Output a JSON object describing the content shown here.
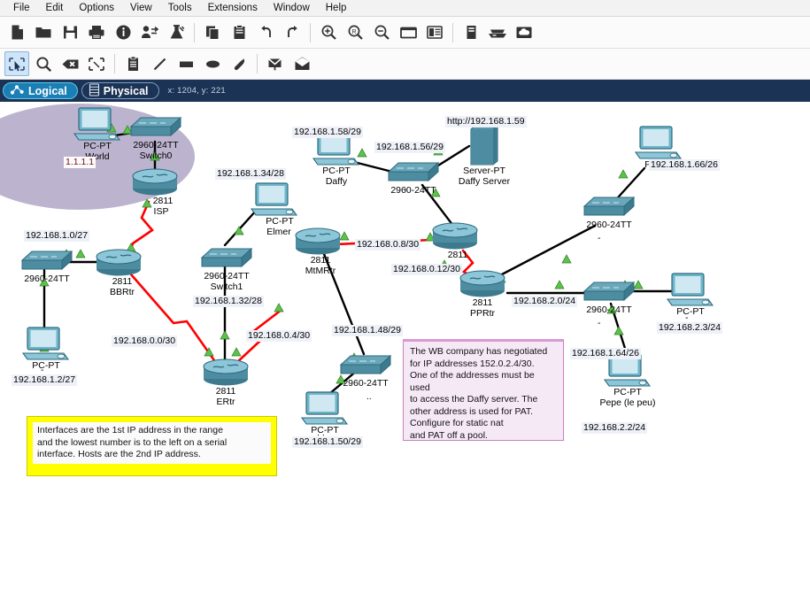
{
  "app": {
    "title": "Cisco Packet Tracer"
  },
  "menubar": {
    "items": [
      {
        "label": "File",
        "name": "menu-file"
      },
      {
        "label": "Edit",
        "name": "menu-edit"
      },
      {
        "label": "Options",
        "name": "menu-options"
      },
      {
        "label": "View",
        "name": "menu-view"
      },
      {
        "label": "Tools",
        "name": "menu-tools"
      },
      {
        "label": "Extensions",
        "name": "menu-extensions"
      },
      {
        "label": "Window",
        "name": "menu-window"
      },
      {
        "label": "Help",
        "name": "menu-help"
      }
    ]
  },
  "toolbar_main": {
    "icons": [
      "new-file-icon",
      "open-folder-icon",
      "save-icon",
      "print-icon",
      "activity-wizard-icon",
      "network-info-icon",
      "flask-icon",
      "sep",
      "copy-icon",
      "paste-icon",
      "undo-icon",
      "redo-icon",
      "sep",
      "zoom-in-icon",
      "zoom-reset-icon",
      "zoom-out-icon",
      "palette-window-icon",
      "user-profile-icon",
      "sep",
      "custom-devices-icon",
      "rack-view-icon",
      "cloud-view-icon"
    ]
  },
  "toolbar_edit": {
    "icons": [
      "select-tool-icon",
      "inspect-magnifier-icon",
      "delete-x-icon",
      "resize-marquee-icon",
      "sep",
      "note-pad-icon",
      "draw-line-icon",
      "draw-rectangle-icon",
      "draw-ellipse-icon",
      "draw-freeform-icon",
      "sep",
      "simple-pdu-icon",
      "complex-pdu-icon"
    ],
    "selected": "select-tool-icon"
  },
  "viewbar": {
    "logical_tab": "Logical",
    "physical_tab": "Physical",
    "coordinates": "x: 1204, y: 221",
    "active_tab": "Logical"
  },
  "topology": {
    "devices": [
      {
        "name": "device-pc-world",
        "type": "pc",
        "model": "PC-PT",
        "hostname": "World",
        "ip": ""
      },
      {
        "name": "device-switch0",
        "type": "switch",
        "model": "2960-24TT",
        "hostname": "Switch0",
        "ip": ""
      },
      {
        "name": "device-router-isp",
        "type": "router",
        "model": "2811",
        "hostname": "ISP",
        "ip": ""
      },
      {
        "name": "device-switch-left",
        "type": "switch",
        "model": "2960-24TT",
        "hostname": "",
        "ip": ""
      },
      {
        "name": "device-router-bbrtr",
        "type": "router",
        "model": "2811",
        "hostname": "BBRtr",
        "ip": ""
      },
      {
        "name": "device-pc-left",
        "type": "pc",
        "model": "PC-PT",
        "hostname": "",
        "ip": "192.168.1.2/27"
      },
      {
        "name": "device-pc-elmer",
        "type": "pc",
        "model": "PC-PT",
        "hostname": "Elmer",
        "ip": ""
      },
      {
        "name": "device-switch1",
        "type": "switch",
        "model": "2960-24TT",
        "hostname": "Switch1",
        "ip": ""
      },
      {
        "name": "device-router-ertr",
        "type": "router",
        "model": "2811",
        "hostname": "ERtr",
        "ip": ""
      },
      {
        "name": "device-router-mtmrtr",
        "type": "router",
        "model": "2811",
        "hostname": "MtMRtr",
        "ip": ""
      },
      {
        "name": "device-pc-daffy",
        "type": "pc",
        "model": "PC-PT",
        "hostname": "Daffy",
        "ip": ""
      },
      {
        "name": "device-switch-daffy",
        "type": "switch",
        "model": "2960-24TT",
        "hostname": "",
        "ip": ""
      },
      {
        "name": "device-server-daffy",
        "type": "server",
        "model": "Server-PT",
        "hostname": "Daffy Server",
        "ip": ""
      },
      {
        "name": "device-router-mid",
        "type": "router",
        "model": "2811",
        "hostname": "",
        "ip": ""
      },
      {
        "name": "device-switch-bottom",
        "type": "switch",
        "model": "2960-24TT",
        "hostname": "",
        "ip": ""
      },
      {
        "name": "device-pc-bottom",
        "type": "pc",
        "model": "PC-PT",
        "hostname": "",
        "ip": "192.168.1.50/29"
      },
      {
        "name": "device-switch-upright",
        "type": "switch",
        "model": "2960-24TT",
        "hostname": "",
        "ip": ""
      },
      {
        "name": "device-pc-upright",
        "type": "pc",
        "model": "PC-PT",
        "hostname": "",
        "ip": "192.168.1.66/26"
      },
      {
        "name": "device-router-pprtr",
        "type": "router",
        "model": "2811",
        "hostname": "PPRtr",
        "ip": ""
      },
      {
        "name": "device-switch-right",
        "type": "switch",
        "model": "2960-24TT",
        "hostname": "",
        "ip": ""
      },
      {
        "name": "device-pc-right",
        "type": "pc",
        "model": "PC-PT",
        "hostname": "",
        "ip": "192.168.2.3/24"
      },
      {
        "name": "device-pc-pepe",
        "type": "pc",
        "model": "PC-PT",
        "hostname": "Pepe (le peu)",
        "ip": "192.168.2.2/24"
      }
    ],
    "labels": {
      "loopback_world": "1.1.1.1",
      "net_left_lan": "192.168.1.0/27",
      "pc_left_ip": "192.168.1.2/27",
      "net_elmer": "192.168.1.34/28",
      "net_switch1": "192.168.1.32/28",
      "net_bbrtr_ertr": "192.168.0.0/30",
      "net_ertr_mtmrtr": "192.168.0.4/30",
      "net_daffy_pc": "192.168.1.58/29",
      "net_daffy_lan": "192.168.1.56/29",
      "server_url": "http://192.168.1.59",
      "net_mtmrtr_mid": "192.168.0.8/30",
      "net_mid_pprtr": "192.168.0.12/30",
      "net_bottom_lan": "192.168.1.48/29",
      "pc_bottom_ip": "192.168.1.50/29",
      "net_upright_lan": "192.168.1.64/26",
      "pc_upright_ip": "192.168.1.66/26",
      "net_pprtr_lan": "192.168.2.0/24",
      "pc_right_ip": "192.168.2.3/24",
      "pc_pepe_ip": "192.168.2.2/24"
    }
  },
  "notes": {
    "yellow": {
      "name": "note-interfaces",
      "lines": [
        "Interfaces are the 1st IP address in the range",
        "and the lowest number is to the left on a serial",
        "interface. Hosts are the 2nd IP address."
      ]
    },
    "pink": {
      "name": "note-nat-requirements",
      "lines": [
        "The WB company has negotiated",
        "for IP addresses 152.0.2.4/30.",
        "One of the addresses must be used",
        "to access the Daffy server. The",
        "other address is used for PAT.",
        "Configure for static nat",
        "and PAT off a pool."
      ]
    }
  },
  "colors": {
    "viewbar_bg": "#1b3354",
    "active_tab": "#1a7fb5",
    "cloud": "#b6aeca",
    "device_teal": "#3f8396",
    "serial_link": "#ff0000",
    "ethernet_link": "#000000",
    "link_up": "#5cc24a",
    "note_yellow": "#ffff00",
    "note_pink": "#f6e9f6"
  }
}
